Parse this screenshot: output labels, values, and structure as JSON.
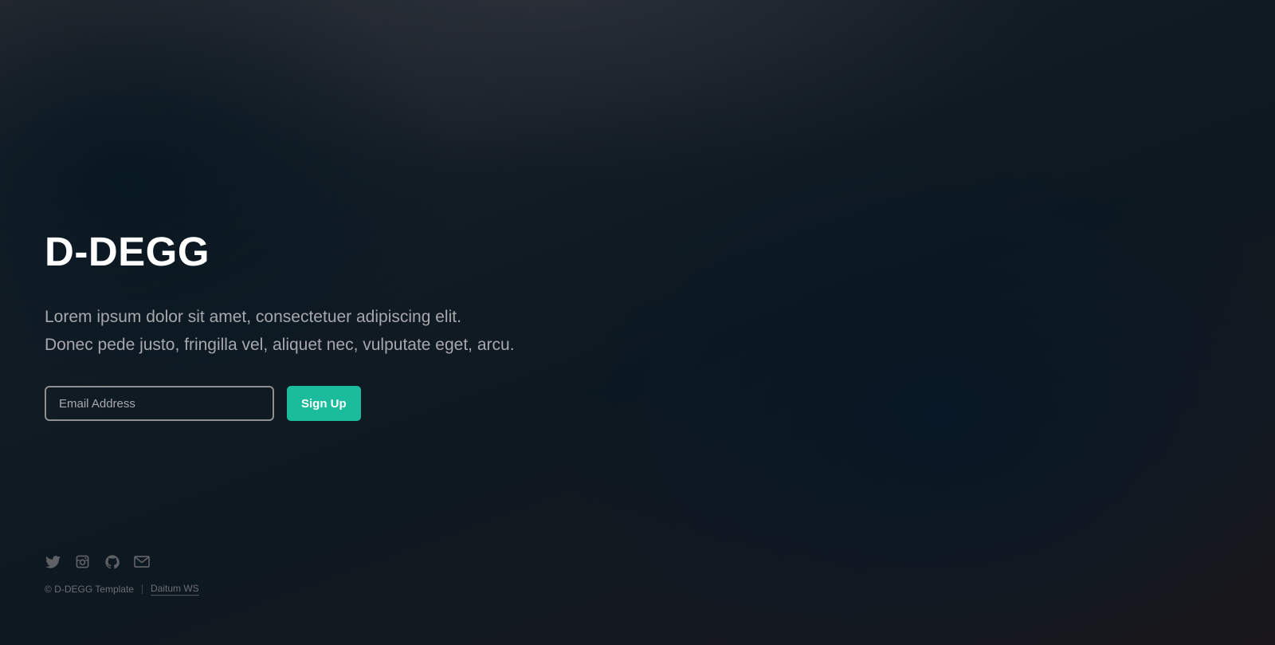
{
  "hero": {
    "title": "D-DEGG",
    "tagline_line1": "Lorem ipsum dolor sit amet, consectetuer adipiscing elit.",
    "tagline_line2": "Donec pede justo, fringilla vel, aliquet nec, vulputate eget, arcu."
  },
  "signup": {
    "email_placeholder": "Email Address",
    "email_value": "",
    "button_label": "Sign Up"
  },
  "footer": {
    "social_icons": [
      "twitter-icon",
      "instagram-icon",
      "github-icon",
      "envelope-icon"
    ],
    "copyright": "© D-DEGG Template",
    "credit_link": "Daitum WS"
  },
  "colors": {
    "accent": "#1bbc9b",
    "title": "#ffffff",
    "tagline": "#a6a8ad",
    "footer_text": "#6d6f74",
    "input_border": "#8e8f92"
  }
}
